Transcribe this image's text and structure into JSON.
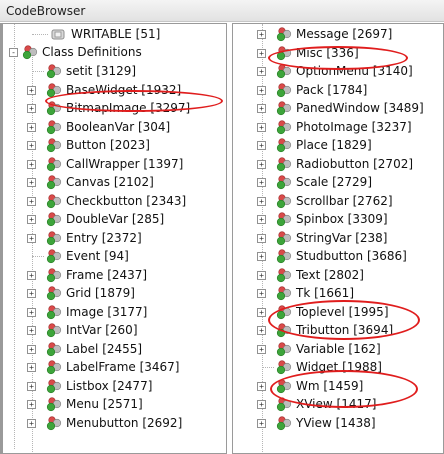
{
  "window": {
    "title": "CodeBrowser"
  },
  "left_tree": {
    "writable_label": "WRITABLE [51]",
    "class_definitions_label": "Class Definitions",
    "items": [
      "setit [3129]",
      "BaseWidget [1932]",
      "BitmapImage [3297]",
      "BooleanVar [304]",
      "Button [2023]",
      "CallWrapper [1397]",
      "Canvas [2102]",
      "Checkbutton [2343]",
      "DoubleVar [285]",
      "Entry [2372]",
      "Event [94]",
      "Frame [2437]",
      "Grid [1879]",
      "Image [3177]",
      "IntVar [260]",
      "Label [2455]",
      "LabelFrame [3467]",
      "Listbox [2477]",
      "Menu [2571]",
      "Menubutton [2692]"
    ]
  },
  "right_tree": {
    "items": [
      "Message [2697]",
      "Misc [336]",
      "OptionMenu [3140]",
      "Pack [1784]",
      "PanedWindow [3489]",
      "PhotoImage [3237]",
      "Place [1829]",
      "Radiobutton [2702]",
      "Scale [2729]",
      "Scrollbar [2762]",
      "Spinbox [3309]",
      "StringVar [238]",
      "Studbutton [3686]",
      "Text [2802]",
      "Tk [1661]",
      "Toplevel [1995]",
      "Tributton [3694]",
      "Variable [162]",
      "Widget [1988]",
      "Wm [1459]",
      "XView [1417]",
      "YView [1438]"
    ]
  },
  "icon": {
    "name": "class-icon"
  },
  "colors": {
    "annotation": "#e01d1d",
    "class_icon_green": "#3da43a",
    "class_icon_red": "#d94a4a",
    "class_icon_gray": "#a9a9a9"
  }
}
